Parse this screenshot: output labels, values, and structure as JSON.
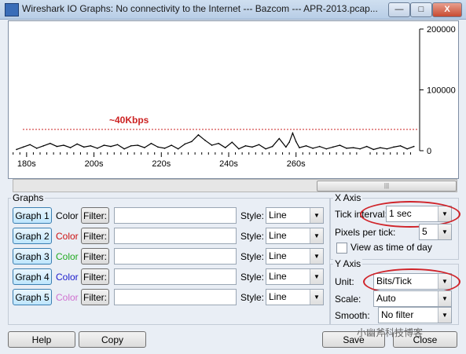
{
  "window": {
    "title": "Wireshark IO Graphs: No connectivity to the Internet --- Bazcom --- APR-2013.pcap...",
    "minimize_label": "—",
    "maximize_label": "□",
    "close_label": "X"
  },
  "chart_data": {
    "type": "line",
    "x_ticks": [
      "180s",
      "200s",
      "220s",
      "240s",
      "260s"
    ],
    "y_ticks": [
      "200000",
      "100000",
      "0"
    ],
    "xlim": [
      177,
      296
    ],
    "ylim": [
      0,
      200000
    ],
    "annotation": "~40Kbps",
    "annotation_value": 35000,
    "colors": {
      "series": "#000000",
      "annotation": "#cc2222"
    },
    "series": [
      {
        "x": [
          177,
          179,
          181,
          183,
          185,
          187,
          189,
          191,
          193,
          195,
          197,
          199,
          201,
          203,
          205,
          207,
          209,
          211,
          213,
          215,
          217,
          219,
          221,
          223,
          225,
          227,
          229,
          231,
          233,
          235,
          237,
          239,
          241,
          243,
          245,
          247,
          249,
          251,
          253,
          255,
          257,
          258,
          259,
          260,
          261,
          263,
          265,
          267,
          269,
          271,
          273,
          275,
          277,
          279,
          281,
          283,
          285,
          287,
          289,
          291,
          293,
          295
        ],
        "y": [
          2000,
          6000,
          10000,
          4000,
          8000,
          12000,
          7000,
          9000,
          5000,
          11000,
          6000,
          8000,
          4000,
          9000,
          7000,
          10000,
          3000,
          8000,
          9000,
          5000,
          12000,
          6000,
          4000,
          9000,
          3000,
          11000,
          15000,
          26000,
          17000,
          9000,
          12000,
          5000,
          14000,
          3000,
          8000,
          6000,
          10000,
          3000,
          7000,
          20000,
          6000,
          14000,
          29000,
          15000,
          5000,
          8000,
          4000,
          7000,
          3000,
          6000,
          9000,
          4000,
          5000,
          3000,
          7000,
          2000,
          5000,
          3000,
          6000,
          8000,
          3000,
          7000
        ]
      }
    ]
  },
  "scrollbar": {
    "grip": "|||"
  },
  "graphs": {
    "group_label": "Graphs",
    "color_label": "Color",
    "filter_label": "Filter:",
    "style_label": "Style:",
    "rows": [
      {
        "label": "Graph 1",
        "color": "#000000",
        "filter": "",
        "style": "Line"
      },
      {
        "label": "Graph 2",
        "color": "#cc1111",
        "filter": "",
        "style": "Line"
      },
      {
        "label": "Graph 3",
        "color": "#22aa22",
        "filter": "",
        "style": "Line"
      },
      {
        "label": "Graph 4",
        "color": "#1a1acc",
        "filter": "",
        "style": "Line"
      },
      {
        "label": "Graph 5",
        "color": "#d070d0",
        "filter": "",
        "style": "Line"
      }
    ]
  },
  "x_axis": {
    "group_label": "X Axis",
    "tick_interval_label": "Tick interval:",
    "tick_interval_value": "1 sec",
    "pixels_per_tick_label": "Pixels per tick:",
    "pixels_per_tick_value": "5",
    "view_as_time_label": "View as time of day",
    "view_as_time_checked": false
  },
  "y_axis": {
    "group_label": "Y Axis",
    "unit_label": "Unit:",
    "unit_value": "Bits/Tick",
    "scale_label": "Scale:",
    "scale_value": "Auto",
    "smooth_label": "Smooth:",
    "smooth_value": "No filter"
  },
  "buttons": {
    "help": "Help",
    "copy": "Copy",
    "save": "Save",
    "close": "Close"
  },
  "watermark": "小幽斧科技博客"
}
